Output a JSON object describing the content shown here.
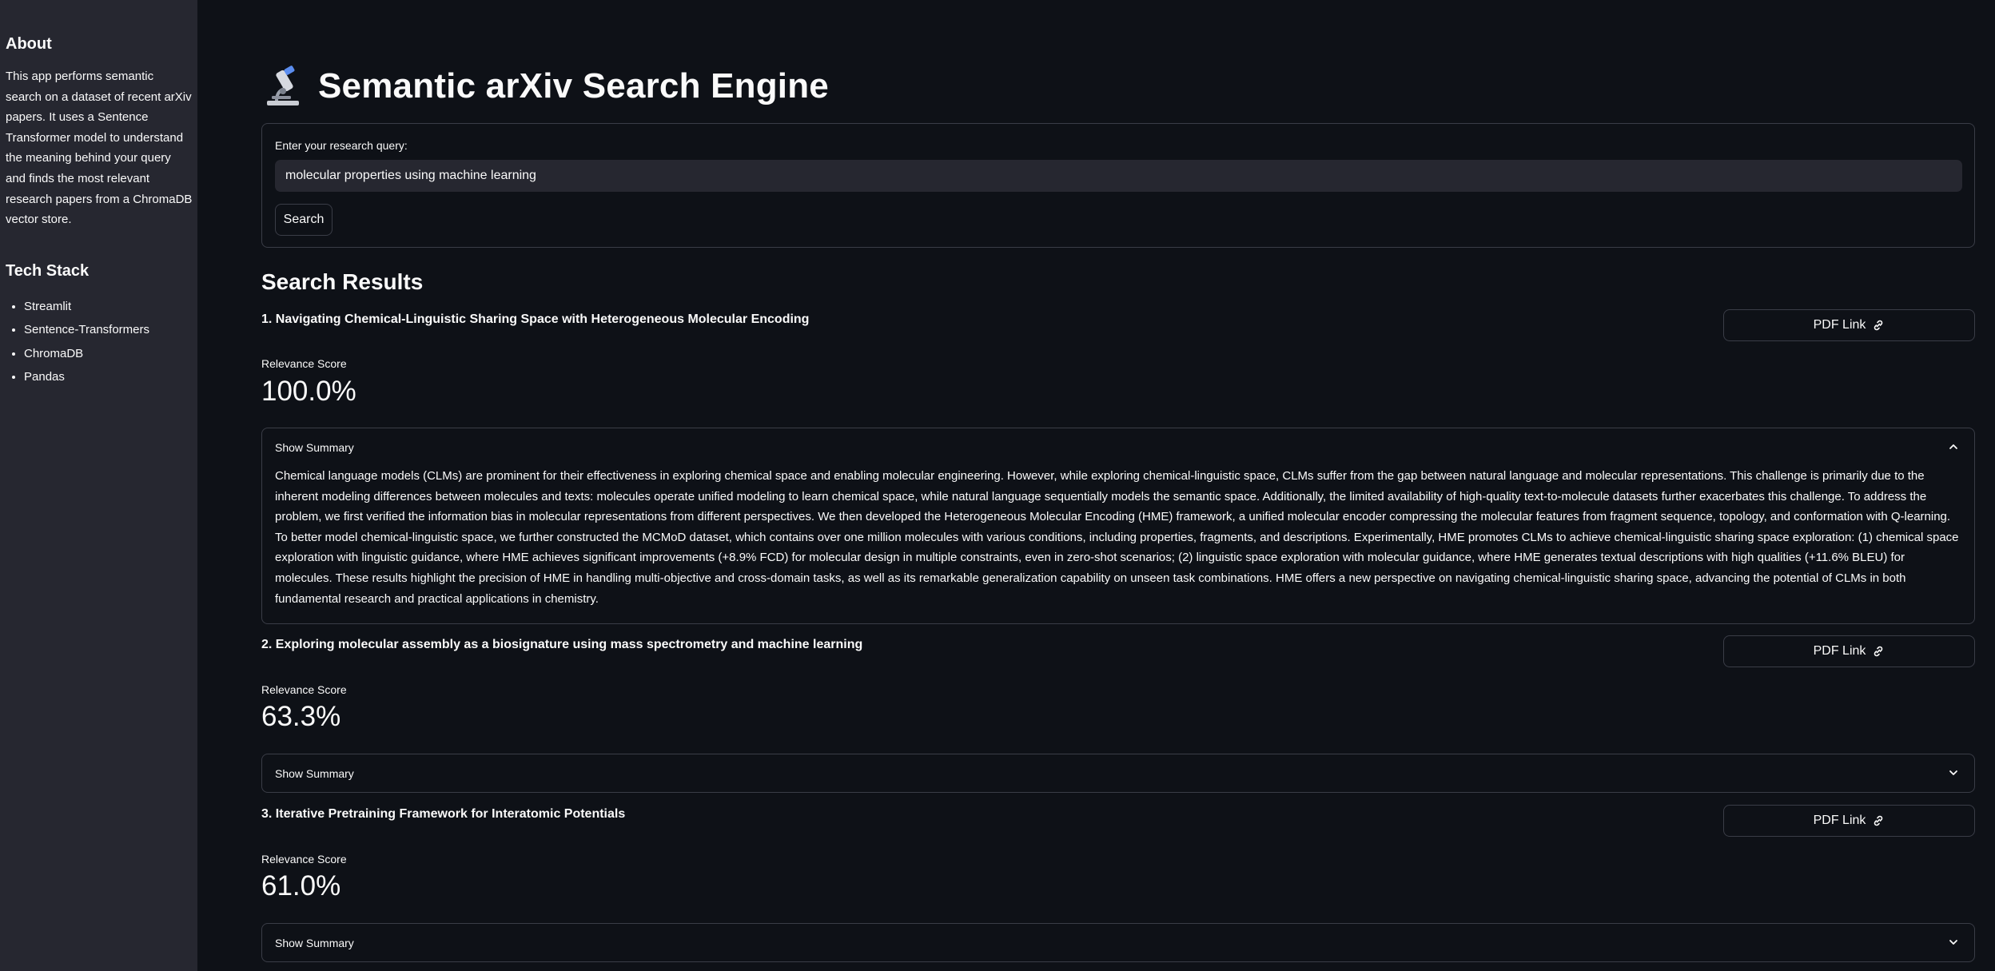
{
  "sidebar": {
    "about_title": "About",
    "about_text": "This app performs semantic search on a dataset of recent arXiv papers. It uses a Sentence Transformer model to understand the meaning behind your query and finds the most relevant research papers from a ChromaDB vector store.",
    "tech_title": "Tech Stack",
    "tech_items": [
      "Streamlit",
      "Sentence-Transformers",
      "ChromaDB",
      "Pandas"
    ]
  },
  "header": {
    "title": "Semantic arXiv Search Engine",
    "icon": "microscope-icon"
  },
  "form": {
    "label": "Enter your research query:",
    "query": "molecular properties using machine learning",
    "search_label": "Search"
  },
  "results_title": "Search Results",
  "results": [
    {
      "title": "1. Navigating Chemical-Linguistic Sharing Space with Heterogeneous Molecular Encoding",
      "pdf_label": "PDF Link",
      "score_label": "Relevance Score",
      "score": "100.0%",
      "summary_label": "Show Summary",
      "expanded": true,
      "summary": "Chemical language models (CLMs) are prominent for their effectiveness in exploring chemical space and enabling molecular engineering. However, while exploring chemical-linguistic space, CLMs suffer from the gap between natural language and molecular representations. This challenge is primarily due to the inherent modeling differences between molecules and texts: molecules operate unified modeling to learn chemical space, while natural language sequentially models the semantic space. Additionally, the limited availability of high-quality text-to-molecule datasets further exacerbates this challenge. To address the problem, we first verified the information bias in molecular representations from different perspectives. We then developed the Heterogeneous Molecular Encoding (HME) framework, a unified molecular encoder compressing the molecular features from fragment sequence, topology, and conformation with Q-learning. To better model chemical-linguistic space, we further constructed the MCMoD dataset, which contains over one million molecules with various conditions, including properties, fragments, and descriptions. Experimentally, HME promotes CLMs to achieve chemical-linguistic sharing space exploration: (1) chemical space exploration with linguistic guidance, where HME achieves significant improvements (+8.9% FCD) for molecular design in multiple constraints, even in zero-shot scenarios; (2) linguistic space exploration with molecular guidance, where HME generates textual descriptions with high qualities (+11.6% BLEU) for molecules. These results highlight the precision of HME in handling multi-objective and cross-domain tasks, as well as its remarkable generalization capability on unseen task combinations. HME offers a new perspective on navigating chemical-linguistic sharing space, advancing the potential of CLMs in both fundamental research and practical applications in chemistry."
    },
    {
      "title": "2. Exploring molecular assembly as a biosignature using mass spectrometry and machine learning",
      "pdf_label": "PDF Link",
      "score_label": "Relevance Score",
      "score": "63.3%",
      "summary_label": "Show Summary",
      "expanded": false
    },
    {
      "title": "3. Iterative Pretraining Framework for Interatomic Potentials",
      "pdf_label": "PDF Link",
      "score_label": "Relevance Score",
      "score": "61.0%",
      "summary_label": "Show Summary",
      "expanded": false
    }
  ],
  "colors": {
    "background": "#0e1117",
    "sidebar": "#262730",
    "border": "#3a3d47",
    "text": "#fafafa"
  }
}
